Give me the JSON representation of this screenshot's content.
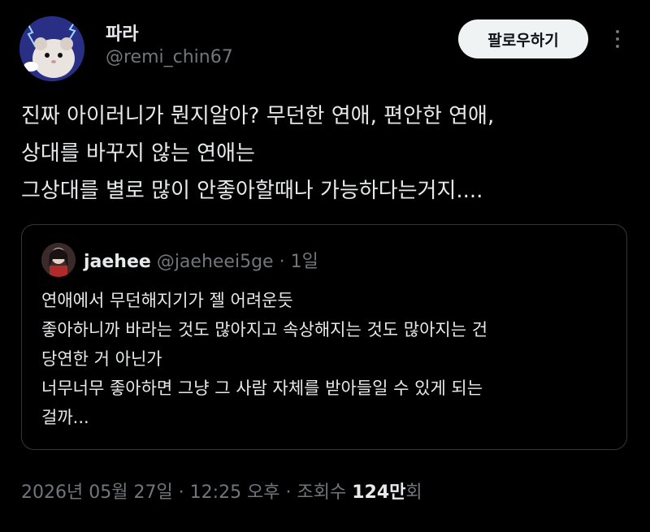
{
  "author": {
    "display_name": "파라",
    "handle": "@remi_chin67",
    "follow_label": "팔로우하기"
  },
  "tweet": {
    "lines": [
      "진짜 아이러니가 뭔지알아? 무던한 연애, 편안한 연애,",
      "상대를 바꾸지 않는 연애는",
      "그상대를 별로 많이 안좋아할때나 가능하다는거지...."
    ]
  },
  "quote": {
    "name": "jaehee",
    "handle": "@jaeheei5ge",
    "separator": "·",
    "time": "1일",
    "lines": [
      "연애에서 무던해지기가 젤 어려운듯",
      "좋아하니까 바라는 것도 많아지고 속상해지는 것도 많아지는 건",
      "당연한 거 아닌가",
      "너무너무 좋아하면 그냥 그 사람 자체를 받아들일 수 있게 되는",
      "걸까..."
    ]
  },
  "meta": {
    "timestamp": "2026년 05월 27일 · 12:25 오후 · 조회수 ",
    "views_count": "124만",
    "views_suffix": "회"
  },
  "colors": {
    "background": "#000000",
    "text": "#e7e9ea",
    "muted": "#71767b",
    "border": "#333639",
    "button_bg": "#eff3f4"
  },
  "icons": {
    "more": "more-dots-icon"
  }
}
